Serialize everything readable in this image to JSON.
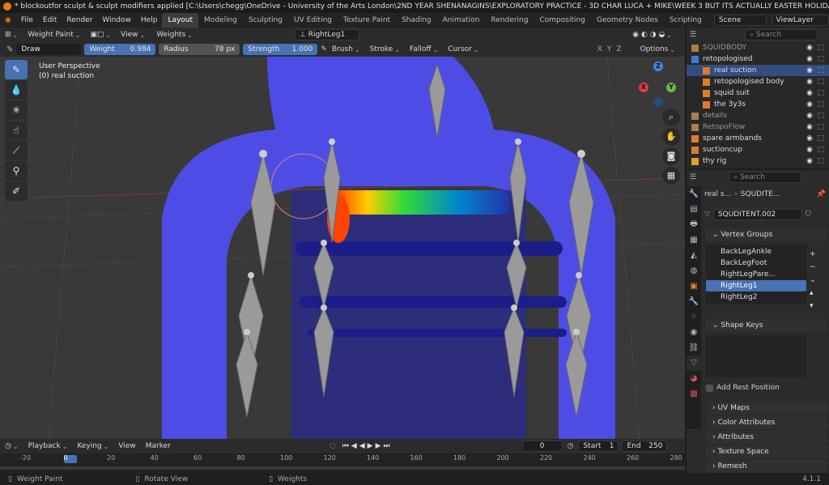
{
  "title_bar": "* blockoutfor sculpt & sculpt modifiers applied [C:\\Users\\chegg\\OneDrive - University of the Arts London\\2ND YEAR SHENANAGINS\\EXPLORATORY PRACTICE - 3D CHAR LUCA + MIKE\\WEEK 3 BUT ITS ACTUALLY EASTER HOLIDAYS IM LAZY\\block...",
  "menu": [
    "File",
    "Edit",
    "Render",
    "Window",
    "Help"
  ],
  "workspaces": [
    "Layout",
    "Modeling",
    "Sculpting",
    "UV Editing",
    "Texture Paint",
    "Shading",
    "Animation",
    "Rendering",
    "Compositing",
    "Geometry Nodes",
    "Scripting"
  ],
  "scene": "Scene",
  "view_layer": "ViewLayer",
  "header": {
    "mode": "Weight Paint",
    "view": "View",
    "weights": "Weights",
    "bone": "RightLeg1"
  },
  "tool_settings": {
    "brush_name": "Draw",
    "weight_label": "Weight",
    "weight_value": "0.984",
    "radius_label": "Radius",
    "radius_value": "78 px",
    "strength_label": "Strength",
    "strength_value": "1.000",
    "brush": "Brush",
    "stroke": "Stroke",
    "falloff": "Falloff",
    "cursor": "Cursor",
    "axes": [
      "X",
      "Y",
      "Z"
    ],
    "options": "Options"
  },
  "viewport": {
    "perspective": "User Perspective",
    "object": "(0) real suction"
  },
  "gizmo": {
    "x": "X",
    "y": "Y",
    "z": "Z",
    "x_color": "#e0384d",
    "y_color": "#6fb73e",
    "z_color": "#3d85e0"
  },
  "outliner": {
    "search_placeholder": "Search",
    "items": [
      {
        "name": "SQUIDBODY",
        "dim": true
      },
      {
        "name": "retopologised",
        "dim": false
      },
      {
        "name": "real suction",
        "selected": true
      },
      {
        "name": "retopologised body",
        "dim": false
      },
      {
        "name": "squid suit",
        "dim": false
      },
      {
        "name": "the 3y3s",
        "dim": false
      },
      {
        "name": "details",
        "dim": true
      },
      {
        "name": "RetopoFlow",
        "dim": true
      },
      {
        "name": "spare armbands",
        "dim": false
      },
      {
        "name": "suctioncup",
        "dim": false
      },
      {
        "name": "thy rig",
        "dim": false
      }
    ]
  },
  "properties": {
    "search_placeholder": "Search",
    "breadcrumb_object": "real s...",
    "breadcrumb_data": "SQUDITE...",
    "mesh_name": "SQUDITENT.002",
    "vertex_groups_title": "Vertex Groups",
    "vertex_groups": [
      "BackLegAnkle",
      "BackLegFoot",
      "RightLegPare...",
      "RightLeg1",
      "RightLeg2"
    ],
    "vertex_group_selected_index": 3,
    "shape_keys_title": "Shape Keys",
    "add_rest_position": "Add Rest Position",
    "panels": [
      "UV Maps",
      "Color Attributes",
      "Attributes",
      "Texture Space",
      "Remesh"
    ]
  },
  "timeline": {
    "playback": "Playback",
    "keying": "Keying",
    "view": "View",
    "marker": "Marker",
    "current_frame": "0",
    "start_label": "Start",
    "start_value": "1",
    "end_label": "End",
    "end_value": "250",
    "ticks": [
      "-20",
      "0",
      "20",
      "40",
      "60",
      "80",
      "100",
      "120",
      "140",
      "160",
      "180",
      "200",
      "220",
      "240",
      "260",
      "280"
    ]
  },
  "status": {
    "left": "Weight Paint",
    "middle": "Rotate View",
    "right": "Weights",
    "version": "4.1.1"
  }
}
